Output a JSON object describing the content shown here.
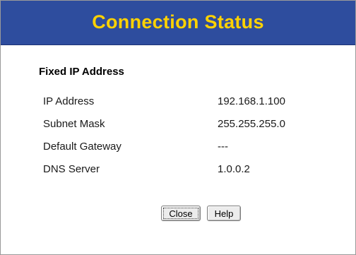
{
  "page": {
    "title": "Connection Status",
    "section_title": "Fixed IP Address"
  },
  "status": {
    "rows": [
      {
        "label": "IP Address",
        "value": "192.168.1.100"
      },
      {
        "label": "Subnet Mask",
        "value": "255.255.255.0"
      },
      {
        "label": "Default Gateway",
        "value": "---"
      },
      {
        "label": "DNS Server",
        "value": "1.0.0.2"
      }
    ]
  },
  "buttons": {
    "close_label": "Close",
    "help_label": "Help"
  },
  "colors": {
    "header_bg": "#2e4d9e",
    "title_text": "#ffd200"
  }
}
